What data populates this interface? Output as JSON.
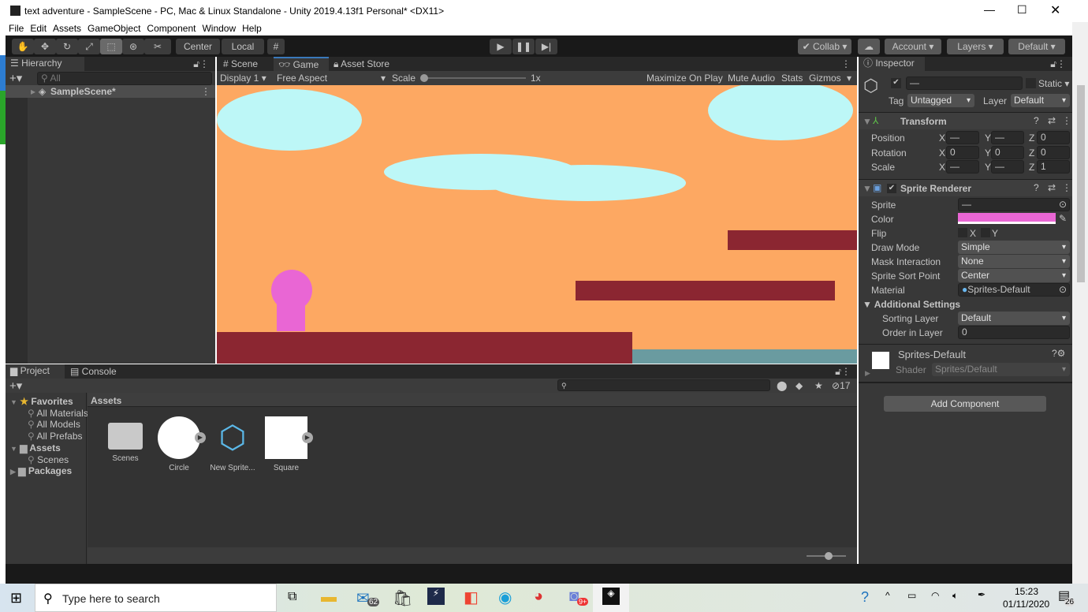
{
  "window": {
    "title": "text adventure - SampleScene - PC, Mac & Linux Standalone - Unity 2019.4.13f1 Personal* <DX11>"
  },
  "menu": [
    "File",
    "Edit",
    "Assets",
    "GameObject",
    "Component",
    "Window",
    "Help"
  ],
  "toolbar": {
    "center": "Center",
    "local": "Local",
    "collab": "Collab",
    "account": "Account",
    "layers": "Layers",
    "layout": "Default"
  },
  "hierarchy": {
    "tab": "Hierarchy",
    "search_placeholder": "All",
    "scene": "SampleScene*"
  },
  "game": {
    "tabs": [
      "Scene",
      "Game",
      "Asset Store"
    ],
    "display": "Display 1",
    "aspect": "Free Aspect",
    "scale_label": "Scale",
    "scale_value": "1x",
    "scale_fraction": 0,
    "maximize": "Maximize On Play",
    "mute": "Mute Audio",
    "stats": "Stats",
    "gizmos": "Gizmos",
    "colors": {
      "sky": "#fda862",
      "cloud": "#bdf7f7",
      "platform": "#8b2631",
      "water": "#6a9ba0",
      "player": "#e966d4"
    }
  },
  "inspector": {
    "tab": "Inspector",
    "name": "—",
    "static": "Static",
    "tag_label": "Tag",
    "tag": "Untagged",
    "layer_label": "Layer",
    "layer": "Default",
    "transform": {
      "title": "Transform",
      "rows": [
        {
          "label": "Position",
          "x": "—",
          "y": "—",
          "z": "0"
        },
        {
          "label": "Rotation",
          "x": "0",
          "y": "0",
          "z": "0"
        },
        {
          "label": "Scale",
          "x": "—",
          "y": "—",
          "z": "1"
        }
      ]
    },
    "sprite_renderer": {
      "title": "Sprite Renderer",
      "sprite_label": "Sprite",
      "sprite": "—",
      "color_label": "Color",
      "color": "#e966d4",
      "flip_label": "Flip",
      "flip_x": "X",
      "flip_y": "Y",
      "draw_mode_label": "Draw Mode",
      "draw_mode": "Simple",
      "mask_label": "Mask Interaction",
      "mask": "None",
      "sort_point_label": "Sprite Sort Point",
      "sort_point": "Center",
      "material_label": "Material",
      "material": "Sprites-Default",
      "additional": "Additional Settings",
      "sorting_layer_label": "Sorting Layer",
      "sorting_layer": "Default",
      "order_label": "Order in Layer",
      "order": "0"
    },
    "material": {
      "name": "Sprites-Default",
      "shader_label": "Shader",
      "shader": "Sprites/Default"
    },
    "add_component": "Add Component"
  },
  "project": {
    "tabs": [
      "Project",
      "Console"
    ],
    "hidden_count": "17",
    "breadcrumb": "Assets",
    "tree": [
      {
        "label": "Favorites",
        "level": 0,
        "bold": true
      },
      {
        "label": "All Materials",
        "level": 1
      },
      {
        "label": "All Models",
        "level": 1
      },
      {
        "label": "All Prefabs",
        "level": 1
      },
      {
        "label": "Assets",
        "level": 0,
        "bold": true
      },
      {
        "label": "Scenes",
        "level": 1
      },
      {
        "label": "Packages",
        "level": 0,
        "bold": true
      }
    ],
    "assets": [
      "Scenes",
      "Circle",
      "New Sprite...",
      "Square"
    ]
  },
  "taskbar": {
    "search_placeholder": "Type here to search",
    "mail_badge": "62",
    "discord_badge": "9+",
    "time": "15:23",
    "date": "01/11/2020",
    "notif": "26"
  }
}
